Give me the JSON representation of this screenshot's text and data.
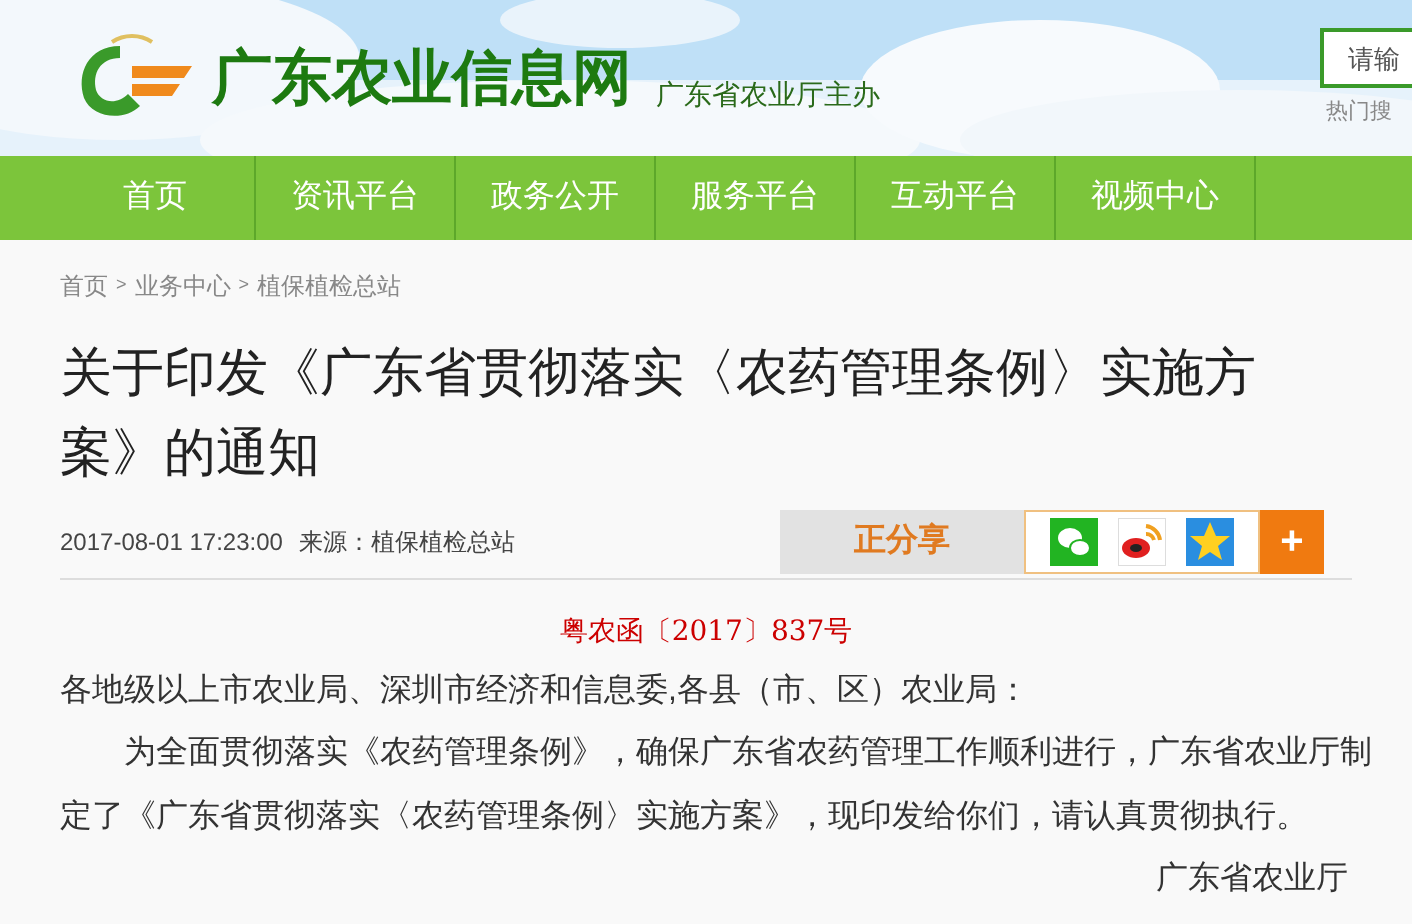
{
  "header": {
    "site_name": "广东农业信息网",
    "subtitle": "广东省农业厅主办",
    "search": {
      "placeholder": "请输"
    },
    "hot_search": "热门搜"
  },
  "nav": [
    {
      "label": "首页"
    },
    {
      "label": "资讯平台"
    },
    {
      "label": "政务公开"
    },
    {
      "label": "服务平台"
    },
    {
      "label": "互动平台"
    },
    {
      "label": "视频中心"
    }
  ],
  "breadcrumb": [
    "首页",
    ">",
    "业务中心",
    ">",
    "植保植检总站"
  ],
  "article": {
    "title": "关于印发《广东省贯彻落实〈农药管理条例〉实施方案》的通知",
    "date": "2017-08-01 17:23:00",
    "source": "来源：植保植检总站",
    "share_label": "正分享",
    "share_more": "+",
    "doc_number": "粤农函〔2017〕837号",
    "salutation": "各地级以上市农业局、深圳市经济和信息委,各县（市、区）农业局：",
    "paragraphs": [
      "为全面贯彻落实《农药管理条例》，确保广东省农药管理工作顺利进行，广东省农业厅制定了《广东省贯彻落实〈农药管理条例〉实施方案》，现印发给你们，请认真贯彻执行。"
    ],
    "signature": "广东省农业厅"
  }
}
